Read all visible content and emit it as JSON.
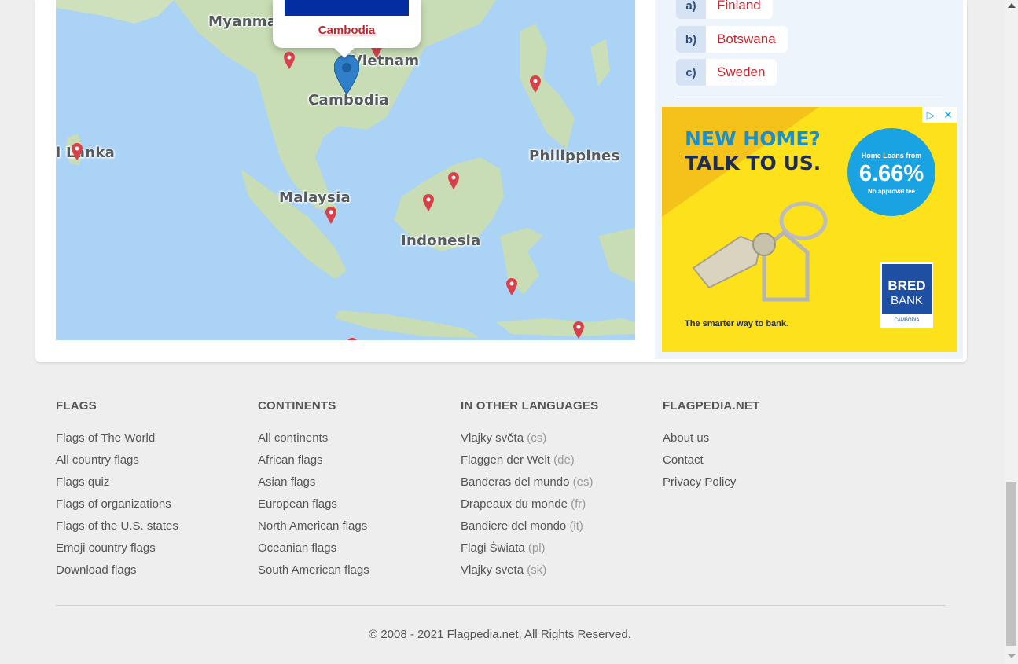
{
  "map": {
    "labels": {
      "myanmar": "Myanma",
      "vietnam": "Vietnam",
      "cambodia": "Cambodia",
      "sri_lanka": "i Lanka",
      "philippines": "Philippines",
      "malaysia": "Malaysia",
      "indonesia": "Indonesia"
    },
    "popup": {
      "link_text": "Cambodia",
      "flag_color": "#032ea1"
    },
    "colors": {
      "water": "#aad3f5",
      "land": "#c8ddb5",
      "pin_red": "#d9414a",
      "pin_blue": "#2f7fca"
    }
  },
  "quiz": {
    "answers": [
      {
        "letter": "a)",
        "name": "Finland"
      },
      {
        "letter": "b)",
        "name": "Botswana"
      },
      {
        "letter": "c)",
        "name": "Sweden"
      }
    ]
  },
  "ad": {
    "headline_1": "NEW HOME?",
    "headline_2": "TALK TO US.",
    "circle_line_1": "Home Loans from",
    "circle_rate": "6.66%",
    "circle_line_3": "No approval fee",
    "bank_line_1": "BRED",
    "bank_line_2": "BANK",
    "bank_line_3": "CAMBODIA",
    "tagline": "The smarter way to bank.",
    "choices_icon": "adchoices-icon",
    "close_icon": "close-icon"
  },
  "footer": {
    "flags": {
      "heading": "FLAGS",
      "links": [
        "Flags of The World",
        "All country flags",
        "Flags quiz",
        "Flags of organizations",
        "Flags of the U.S. states",
        "Emoji country flags",
        "Download flags"
      ]
    },
    "continents": {
      "heading": "CONTINENTS",
      "links": [
        "All continents",
        "African flags",
        "Asian flags",
        "European flags",
        "North American flags",
        "Oceanian flags",
        "South American flags"
      ]
    },
    "languages": {
      "heading": "IN OTHER LANGUAGES",
      "links": [
        {
          "text": "Vlajky světa",
          "code": "(cs)"
        },
        {
          "text": "Flaggen der Welt",
          "code": "(de)"
        },
        {
          "text": "Banderas del mundo",
          "code": "(es)"
        },
        {
          "text": "Drapeaux du monde",
          "code": "(fr)"
        },
        {
          "text": "Bandiere del mondo",
          "code": "(it)"
        },
        {
          "text": "Flagi Świata",
          "code": "(pl)"
        },
        {
          "text": "Vlajky sveta",
          "code": "(sk)"
        }
      ]
    },
    "site": {
      "heading": "FLAGPEDIA.NET",
      "links": [
        "About us",
        "Contact",
        "Privacy Policy"
      ]
    },
    "copyright": "© 2008 - 2021 Flagpedia.net, All Rights Reserved."
  }
}
